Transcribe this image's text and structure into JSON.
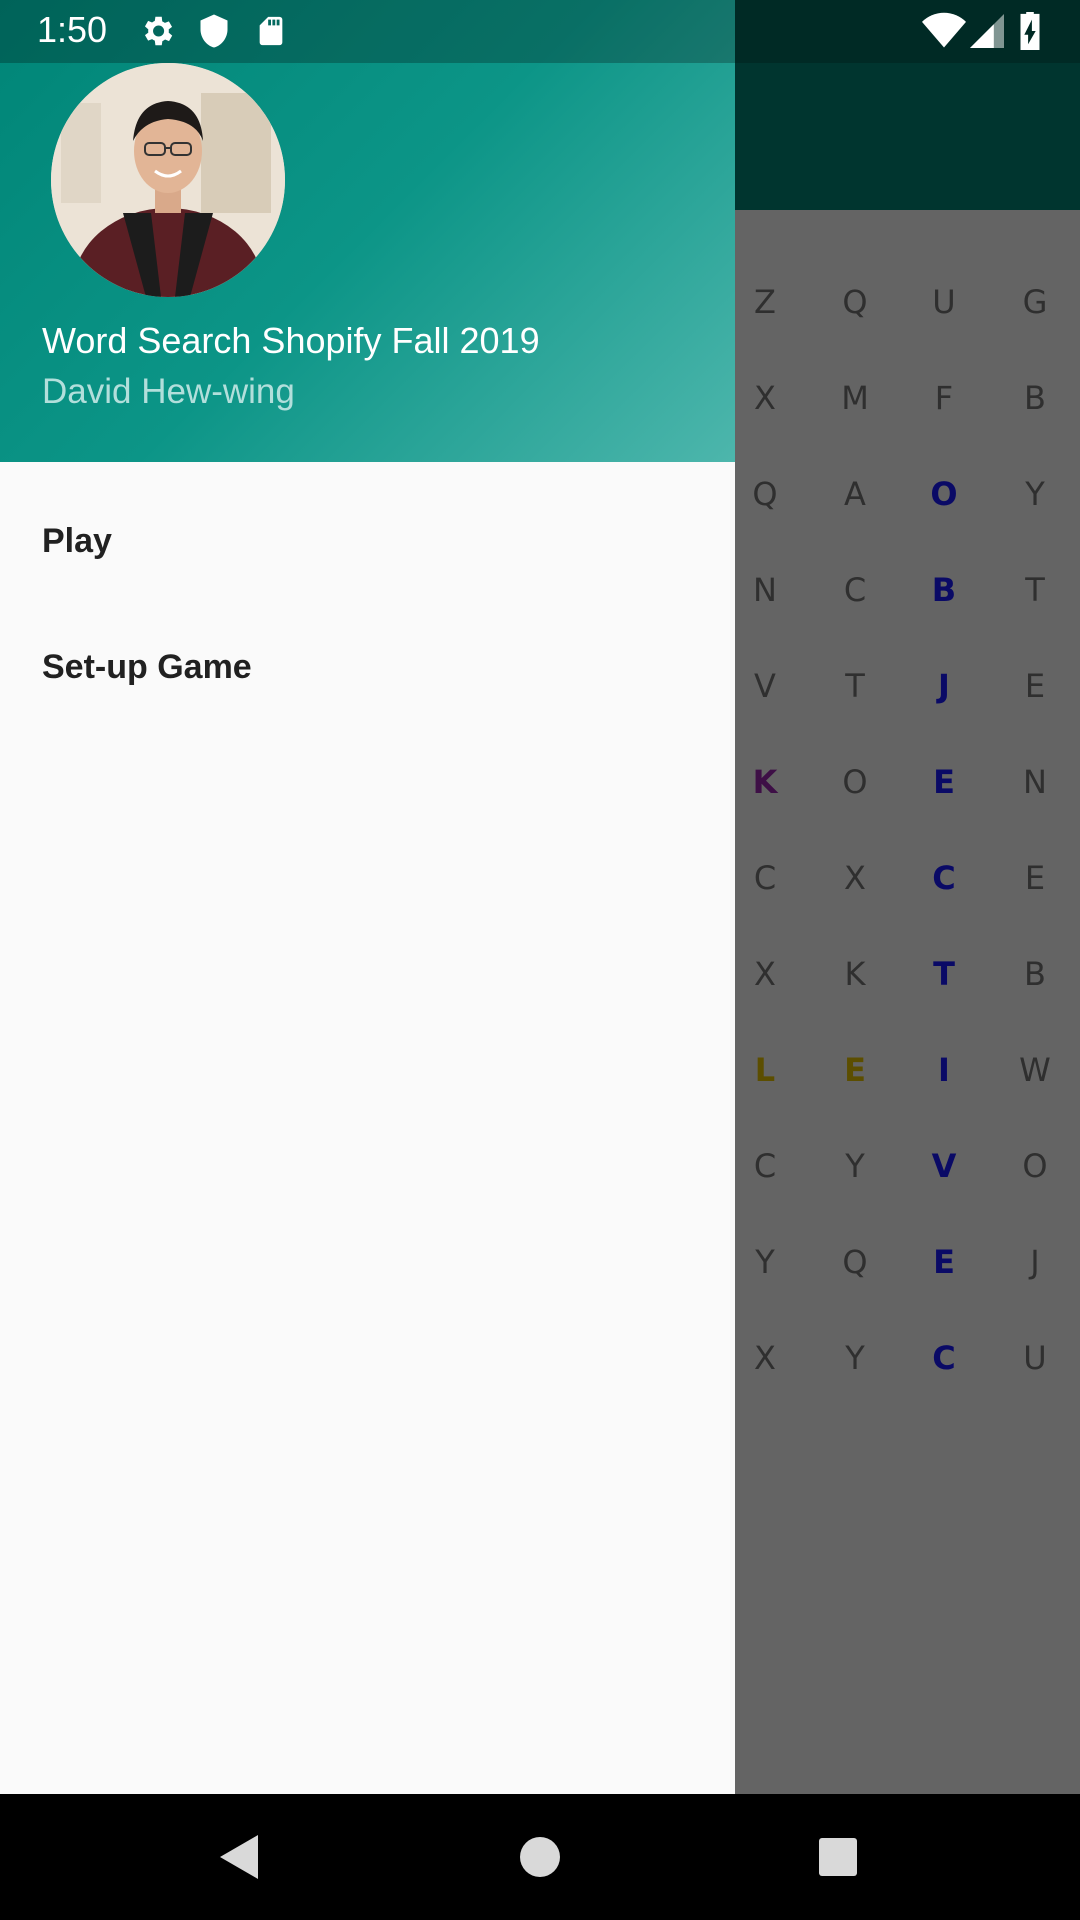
{
  "status_bar": {
    "time": "1:50",
    "icons": [
      "settings-icon",
      "shield-icon",
      "sd-card-icon",
      "wifi-icon",
      "signal-icon",
      "battery-icon"
    ]
  },
  "drawer": {
    "title": "Word Search Shopify Fall 2019",
    "subtitle": "David Hew-wing",
    "menu": [
      {
        "label": "Play"
      },
      {
        "label": "Set-up Game"
      }
    ]
  },
  "grid": {
    "rows": [
      [
        "Z",
        "Q",
        "U",
        "G"
      ],
      [
        "X",
        "M",
        "F",
        "B"
      ],
      [
        "Q",
        "A",
        "O",
        "Y"
      ],
      [
        "N",
        "C",
        "B",
        "T"
      ],
      [
        "V",
        "T",
        "J",
        "E"
      ],
      [
        "K",
        "O",
        "E",
        "N"
      ],
      [
        "C",
        "X",
        "C",
        "E"
      ],
      [
        "X",
        "K",
        "T",
        "B"
      ],
      [
        "L",
        "E",
        "I",
        "W"
      ],
      [
        "C",
        "Y",
        "V",
        "O"
      ],
      [
        "Y",
        "Q",
        "E",
        "J"
      ],
      [
        "X",
        "Y",
        "C",
        "U"
      ]
    ],
    "highlighted": [
      {
        "row": 2,
        "col": 2,
        "color": "#1a1aff"
      },
      {
        "row": 3,
        "col": 2,
        "color": "#1a1aff"
      },
      {
        "row": 4,
        "col": 2,
        "color": "#1a1aff"
      },
      {
        "row": 5,
        "col": 2,
        "color": "#1a1aff"
      },
      {
        "row": 6,
        "col": 2,
        "color": "#1a1aff"
      },
      {
        "row": 7,
        "col": 2,
        "color": "#1a1aff"
      },
      {
        "row": 8,
        "col": 2,
        "color": "#1a1aff"
      },
      {
        "row": 9,
        "col": 2,
        "color": "#1a1aff"
      },
      {
        "row": 10,
        "col": 2,
        "color": "#1a1aff"
      },
      {
        "row": 11,
        "col": 2,
        "color": "#1a1aff"
      },
      {
        "row": 5,
        "col": 0,
        "color": "#9c27b0"
      },
      {
        "row": 8,
        "col": 0,
        "color": "#e6c200"
      },
      {
        "row": 8,
        "col": 1,
        "color": "#e6c200"
      }
    ]
  },
  "nav_bar": {
    "icons": [
      "back-icon",
      "home-icon",
      "recents-icon"
    ]
  },
  "colors": {
    "primary": "#008577",
    "primary_dark": "#00574b",
    "accent": "#4db6ac"
  }
}
